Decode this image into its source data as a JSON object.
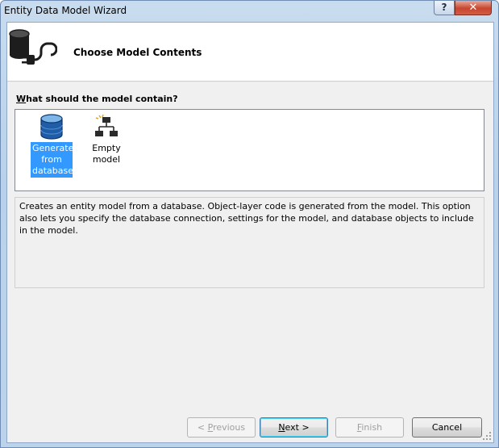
{
  "window": {
    "title": "Entity Data Model Wizard"
  },
  "titlebar": {
    "help_label": "?",
    "close_label": "✕"
  },
  "header": {
    "title": "Choose Model Contents"
  },
  "main": {
    "question_prefix": "W",
    "question_rest": "hat should the model contain?",
    "options": [
      {
        "label": "Generate from database",
        "icon": "database-icon",
        "selected": true
      },
      {
        "label": "Empty model",
        "icon": "hierarchy-icon",
        "selected": false
      }
    ],
    "description": "Creates an entity model from a database. Object-layer code is generated from the model. This option also lets you specify the database connection, settings for the model, and database objects to include in the model."
  },
  "buttons": {
    "previous_prefix": "< ",
    "previous_key": "P",
    "previous_rest": "revious",
    "next_key": "N",
    "next_rest": "ext >",
    "finish_key": "F",
    "finish_rest": "inish",
    "cancel": "Cancel"
  },
  "colors": {
    "selection": "#3399ff",
    "title_bar": "#b9d1ea",
    "close_button": "#c7462f"
  }
}
